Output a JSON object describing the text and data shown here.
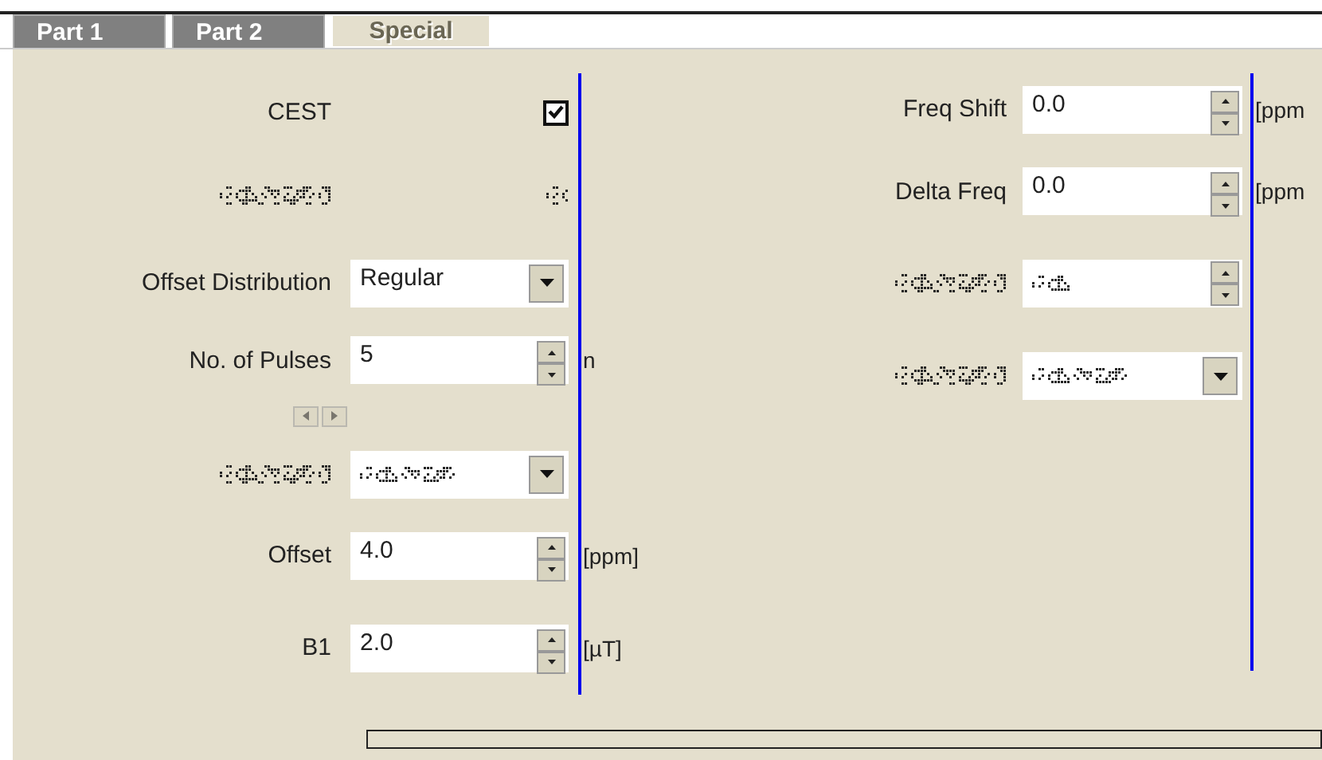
{
  "tabs": [
    {
      "label": "Part 1",
      "selected": false
    },
    {
      "label": "Part 2",
      "selected": false
    },
    {
      "label": "Special",
      "selected": true
    }
  ],
  "left_rows": [
    {
      "kind": "checkbox",
      "label": "CEST",
      "checked": true,
      "disabled": false
    },
    {
      "kind": "checkbox",
      "disabled": true
    },
    {
      "kind": "select",
      "label": "Offset Distribution",
      "value": "Regular",
      "disabled": false
    },
    {
      "kind": "spinner",
      "label": "No. of Pulses",
      "value": "5",
      "unit": "n",
      "disabled": false
    },
    {
      "kind": "nav_arrows",
      "disabled": true
    },
    {
      "kind": "select",
      "disabled": true
    },
    {
      "kind": "spinner",
      "label": "Offset",
      "value": "4.0",
      "unit": "[ppm]",
      "disabled": false
    },
    {
      "kind": "spinner",
      "label": "B1",
      "value": "2.0",
      "unit": "[µT]",
      "disabled": false
    }
  ],
  "right_rows": [
    {
      "kind": "spinner",
      "label": "Freq Shift",
      "value": "0.0",
      "unit": "[ppm",
      "disabled": false
    },
    {
      "kind": "spinner",
      "label": "Delta Freq",
      "value": "0.0",
      "unit": "[ppm",
      "disabled": false
    },
    {
      "kind": "spinner",
      "disabled": true
    },
    {
      "kind": "select",
      "disabled": true
    }
  ]
}
